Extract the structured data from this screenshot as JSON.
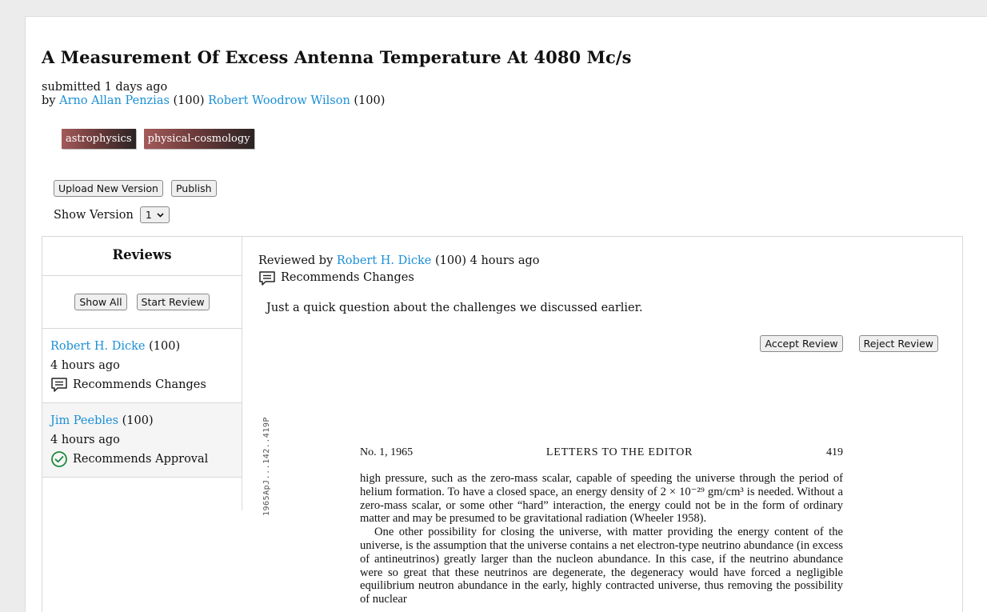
{
  "paper": {
    "title": "A Measurement Of Excess Antenna Temperature At 4080 Mc/s",
    "submitted": "submitted 1 days ago",
    "by_label": "by",
    "authors": [
      {
        "name": "Arno Allan Penzias",
        "score": "(100)"
      },
      {
        "name": "Robert Woodrow Wilson",
        "score": "(100)"
      }
    ],
    "tags": [
      "astrophysics",
      "physical-cosmology"
    ]
  },
  "actions": {
    "upload_label": "Upload New Version",
    "publish_label": "Publish",
    "show_version_label": "Show Version",
    "version_value": "1"
  },
  "reviews": {
    "heading": "Reviews",
    "show_all_label": "Show All",
    "start_review_label": "Start Review",
    "items": [
      {
        "name": "Robert H. Dicke",
        "score": "(100)",
        "time": "4 hours ago",
        "status": "Recommends Changes",
        "icon": "comment-icon"
      },
      {
        "name": "Jim Peebles",
        "score": "(100)",
        "time": "4 hours ago",
        "status": "Recommends Approval",
        "icon": "check-circle-icon"
      }
    ]
  },
  "selected_review": {
    "reviewed_by_label": "Reviewed by",
    "reviewer": "Robert H. Dicke",
    "score": "(100)",
    "time": "4 hours ago",
    "status": "Recommends Changes",
    "body": "Just a quick question about the challenges we discussed earlier.",
    "accept_label": "Accept Review",
    "reject_label": "Reject Review"
  },
  "document": {
    "stamp": "1965ApJ...142..419P",
    "header_left": "No. 1, 1965",
    "header_center": "LETTERS TO THE EDITOR",
    "header_right": "419",
    "para1": "high pressure, such as the zero-mass scalar, capable of speeding the universe through the period of helium formation. To have a closed space, an energy density of 2 × 10⁻²⁹ gm/cm³ is needed. Without a zero-mass scalar, or some other “hard” interaction, the energy could not be in the form of ordinary matter and may be presumed to be gravitational radiation (Wheeler 1958).",
    "para2": "One other possibility for closing the universe, with matter providing the energy content of the universe, is the assumption that the universe contains a net electron-type neutrino abundance (in excess of antineutrinos) greatly larger than the nucleon abundance. In this case, if the neutrino abundance were so great that these neutrinos are degenerate, the degeneracy would have forced a negligible equilibrium neutron abundance in the early, highly contracted universe, thus removing the possibility of nuclear"
  },
  "colors": {
    "link": "#1a8fd6",
    "tag_gradient_start": "#a45a5a",
    "tag_gradient_end": "#2b2323",
    "approval_green": "#1e8a3e"
  }
}
